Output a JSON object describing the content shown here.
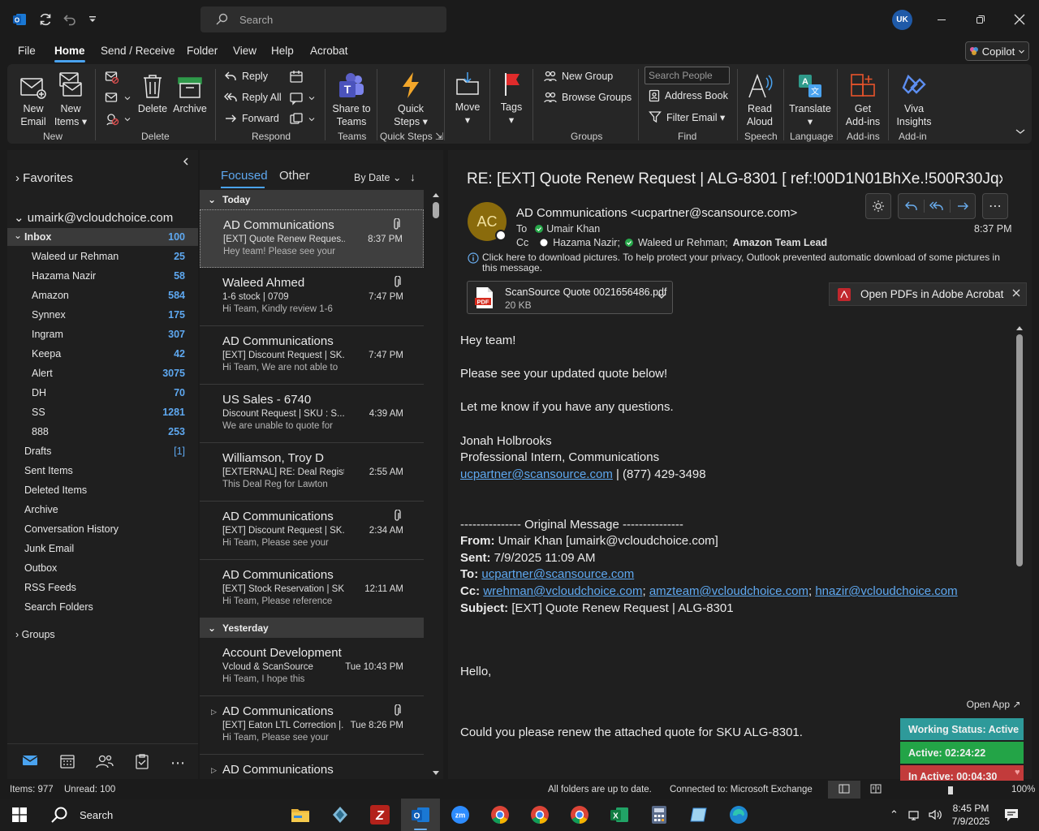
{
  "titlebar": {
    "search_placeholder": "Search",
    "avatar_initials": "UK"
  },
  "menu": {
    "tabs": [
      "File",
      "Home",
      "Send / Receive",
      "Folder",
      "View",
      "Help",
      "Acrobat"
    ],
    "active": "Home",
    "copilot": "Copilot"
  },
  "ribbon": {
    "new_email": [
      "New",
      "Email"
    ],
    "new_items": [
      "New",
      "Items"
    ],
    "delete": "Delete",
    "archive": "Archive",
    "reply": "Reply",
    "reply_all": "Reply All",
    "forward": "Forward",
    "share_teams": [
      "Share to",
      "Teams"
    ],
    "quick_steps": [
      "Quick",
      "Steps"
    ],
    "move": "Move",
    "tags": "Tags",
    "new_group": "New Group",
    "browse_groups": "Browse Groups",
    "search_people": "Search People",
    "address_book": "Address Book",
    "filter_email": "Filter Email",
    "read_aloud": [
      "Read",
      "Aloud"
    ],
    "translate": "Translate",
    "get_addins": [
      "Get",
      "Add-ins"
    ],
    "viva": [
      "Viva",
      "Insights"
    ],
    "groups": [
      "New",
      "Delete",
      "Respond",
      "Teams",
      "Quick Steps",
      "Groups",
      "Find",
      "Speech",
      "Language",
      "Add-ins",
      "Add-in"
    ]
  },
  "nav": {
    "favorites": "Favorites",
    "account": "umairk@vcloudchoice.com",
    "inbox": {
      "label": "Inbox",
      "count": "100"
    },
    "subfolders": [
      {
        "label": "Waleed ur Rehman",
        "count": "25"
      },
      {
        "label": "Hazama Nazir",
        "count": "58"
      },
      {
        "label": "Amazon",
        "count": "584"
      },
      {
        "label": "Synnex",
        "count": "175"
      },
      {
        "label": "Ingram",
        "count": "307"
      },
      {
        "label": "Keepa",
        "count": "42"
      },
      {
        "label": "Alert",
        "count": "3075"
      },
      {
        "label": "DH",
        "count": "70"
      },
      {
        "label": "SS",
        "count": "1281"
      },
      {
        "label": "888",
        "count": "253"
      }
    ],
    "drafts": {
      "label": "Drafts",
      "count": "[1]"
    },
    "folders": [
      "Sent Items",
      "Deleted Items",
      "Archive",
      "Conversation History",
      "Junk Email",
      "Outbox",
      "RSS Feeds",
      "Search Folders"
    ],
    "groups": "Groups"
  },
  "list": {
    "tab_focused": "Focused",
    "tab_other": "Other",
    "sort": "By Date",
    "group_today": "Today",
    "group_yesterday": "Yesterday",
    "messages": [
      {
        "sender": "AD Communications",
        "subject": "[EXT] Quote Renew Reques...",
        "preview": "Hey team!  Please see your",
        "time": "8:37 PM",
        "attach": true
      },
      {
        "sender": "Waleed Ahmed",
        "subject": "1-6 stock | 0709",
        "preview": "Hi Team,  Kindly review 1-6",
        "time": "7:47 PM",
        "attach": true
      },
      {
        "sender": "AD Communications",
        "subject": "[EXT] Discount Request | SK...",
        "preview": "Hi Team,   We are not able to",
        "time": "7:47 PM",
        "attach": false
      },
      {
        "sender": "US Sales - 6740",
        "subject": "Discount Request | SKU : S...",
        "preview": "We are unable to quote for",
        "time": "4:39 AM",
        "attach": false
      },
      {
        "sender": "Williamson, Troy D",
        "subject": "[EXTERNAL] RE: Deal Regist...",
        "preview": "This Deal Reg for Lawton",
        "time": "2:55 AM",
        "attach": false
      },
      {
        "sender": "AD Communications",
        "subject": "[EXT] Discount Request | SK...",
        "preview": "Hi Team,   Please see your",
        "time": "2:34 AM",
        "attach": true
      },
      {
        "sender": "AD Communications",
        "subject": "[EXT] Stock Reservation | SK...",
        "preview": "Hi Team,   Please reference",
        "time": "12:11 AM",
        "attach": false
      },
      {
        "sender": "Account Development",
        "subject": "Vcloud & ScanSource",
        "preview": "Hi Team,    I hope this",
        "time": "Tue 10:43 PM",
        "attach": false
      },
      {
        "sender": "AD Communications",
        "subject": "[EXT] Eaton LTL Correction |...",
        "preview": "Hi Team,   Please see your",
        "time": "Tue 8:26 PM",
        "attach": true
      },
      {
        "sender": "AD Communications",
        "subject": "",
        "preview": "",
        "time": "",
        "attach": false
      }
    ]
  },
  "reading": {
    "subject": "RE: [EXT] Quote Renew Request | ALG-8301    [ ref:!00D1N01BhXe.!500R30Jqx...",
    "avatar": "AC",
    "from": "AD Communications <ucpartner@scansource.com>",
    "to_label": "To",
    "to": "Umair Khan",
    "cc_label": "Cc",
    "cc1": "Hazama Nazir;",
    "cc2": "Waleed ur Rehman;",
    "cc3": "Amazon Team Lead",
    "time": "8:37 PM",
    "info": "Click here to download pictures. To help protect your privacy, Outlook prevented automatic download of some pictures in this message.",
    "attachment_name": "ScanSource Quote 0021656486.pdf",
    "attachment_size": "20 KB",
    "acrobat": "Open PDFs in Adobe Acrobat",
    "body": {
      "greeting": "Hey team!",
      "line1": "Please see your updated quote below!",
      "line2": "Let me know if you have any questions.",
      "sig_name": "Jonah Holbrooks",
      "sig_title": "Professional Intern, Communications",
      "sig_email": "ucpartner@scansource.com",
      "sig_phone": " | (877) 429-3498",
      "orig": "--------------- Original Message ---------------",
      "from_label": "From:",
      "from_val": " Umair Khan [umairk@vcloudchoice.com]",
      "sent_label": "Sent:",
      "sent_val": " 7/9/2025 11:09 AM",
      "to_label": "To:",
      "to_val": "ucpartner@scansource.com",
      "cc_label": "Cc:",
      "cc_a": "wrehman@vcloudchoice.com",
      "cc_b": "amzteam@vcloudchoice.com",
      "cc_c": "hnazir@vcloudchoice.com",
      "subj_label": "Subject:",
      "subj_val": " [EXT] Quote Renew Request | ALG-8301",
      "hello": "Hello,",
      "request": "Could you please renew the attached quote for SKU ALG-8301."
    }
  },
  "widget": {
    "open_app": "Open App ↗",
    "working": "Working Status: Active",
    "active": "Active: 02:24:22",
    "inactive": "In Active: 00:04:30"
  },
  "status": {
    "items": "Items: 977",
    "unread": "Unread: 100",
    "sync": "All folders are up to date.",
    "connected": "Connected to: Microsoft Exchange",
    "zoom": "100%"
  },
  "taskbar": {
    "search": "Search",
    "time": "8:45 PM",
    "date": "7/9/2025"
  },
  "colors": {
    "accent": "#4aa3f0",
    "working": "#2f9a9a",
    "active": "#27a84a",
    "inactive": "#c23b3b"
  }
}
